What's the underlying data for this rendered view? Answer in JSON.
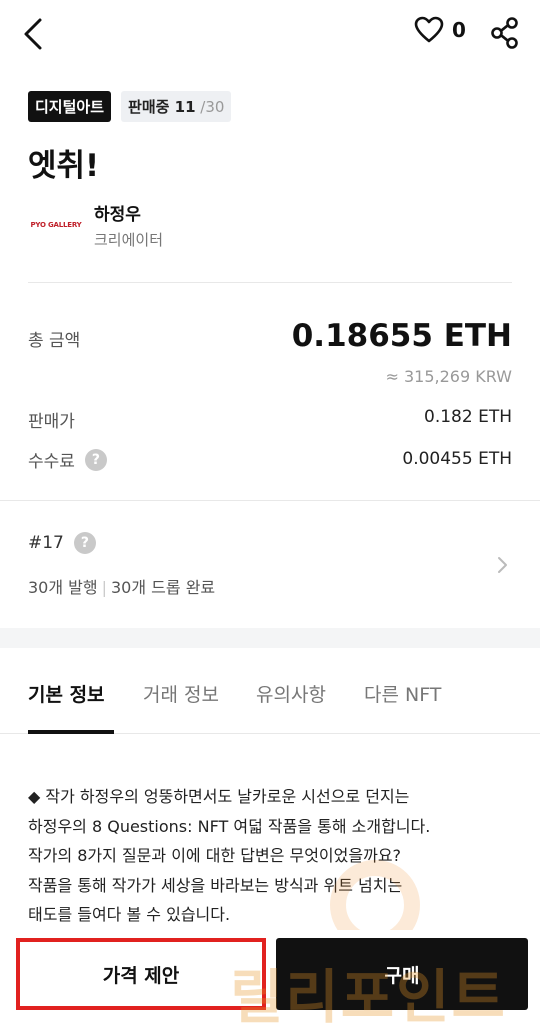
{
  "header": {
    "back_icon": "chevron-left-icon",
    "like_icon": "heart-icon",
    "like_count": "0",
    "share_icon": "share-icon"
  },
  "badges": {
    "category": "디지털아트",
    "sale_label": "판매중 11",
    "sale_total": " /30"
  },
  "title": "엣취!",
  "creator": {
    "logo_text": "PYO GALLERY",
    "name": "하정우",
    "role": "크리에이터"
  },
  "price": {
    "total_label": "총 금액",
    "total_value": "0.18655 ETH",
    "krw_value": "≈ 315,269 KRW",
    "sale_price_label": "판매가",
    "sale_price_value": "0.182 ETH",
    "fee_label": "수수료",
    "fee_value": "0.00455 ETH"
  },
  "edition": {
    "number": "#17",
    "issued": "30개 발행",
    "dropped": "30개 드롭 완료"
  },
  "tabs": [
    {
      "label": "기본 정보"
    },
    {
      "label": "거래 정보"
    },
    {
      "label": "유의사항"
    },
    {
      "label": "다른 NFT"
    }
  ],
  "description": [
    "◆ 작가 하정우의 엉뚱하면서도 날카로운 시선으로 던지는",
    "하정우의 8 Questions: NFT 여덟 작품을 통해 소개합니다.",
    "작가의 8가지 질문과 이에 대한 답변은 무엇이었을까요?",
    "작품을 통해 작가가 세상을 바라보는 방식과 위트 넘치는",
    "태도를 들여다 볼 수 있습니다."
  ],
  "actions": {
    "offer_label": "가격 제안",
    "buy_label": "구매"
  },
  "watermark": "릴리포인트",
  "colors": {
    "accent_red": "#e1211f",
    "primary": "#111111",
    "muted": "#999999"
  }
}
